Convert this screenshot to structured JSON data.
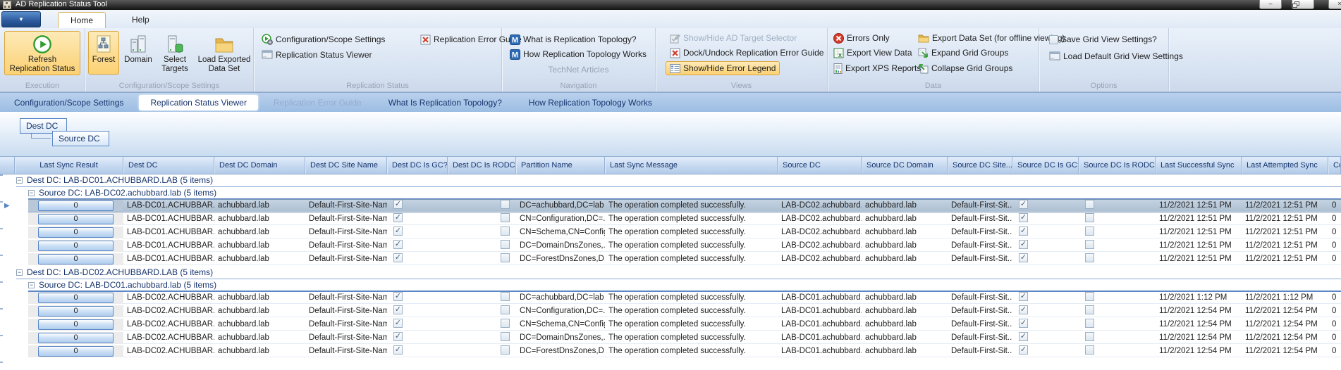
{
  "window": {
    "title": "AD Replication Status Tool"
  },
  "colors": {
    "ribbon_highlight_orange": "#fcd173",
    "selection_row_blue": "#b5c7da",
    "tabstrip_blue": "#a9c6e8",
    "group_text_blue": "#17356e",
    "status_green": "#2e9e2e",
    "error_red": "#d23c2a"
  },
  "icons": {
    "app_menu_arrow": "▼",
    "collapse_box": "−",
    "row_selector": "▶",
    "check": "✓",
    "minimize": "–",
    "close": "×"
  },
  "ribbon": {
    "tabs": {
      "home": "Home",
      "help": "Help"
    },
    "execution": {
      "label": "Execution",
      "refresh": "Refresh Replication Status"
    },
    "scope": {
      "label": "Configuration/Scope Settings",
      "forest": "Forest",
      "domain": "Domain",
      "select_targets": "Select Targets",
      "load_exported": "Load Exported Data Set"
    },
    "replication_status": {
      "label": "Replication Status",
      "config_scope": "Configuration/Scope Settings",
      "viewer": "Replication Status Viewer",
      "error_guide": "Replication Error Guide"
    },
    "navigation": {
      "label": "Navigation",
      "sublabel": "TechNet Articles",
      "what_is": "What is Replication Topology?",
      "how_works": "How Replication Topology Works"
    },
    "views": {
      "label": "Views",
      "target_selector": "Show/Hide AD Target Selector",
      "dock": "Dock/Undock Replication Error Guide",
      "legend": "Show/Hide Error Legend"
    },
    "data": {
      "label": "Data",
      "errors_only": "Errors Only",
      "export_view": "Export View Data",
      "export_xps": "Export XPS Reports",
      "export_dataset": "Export Data Set (for offline viewing)",
      "expand": "Expand Grid Groups",
      "collapse": "Collapse Grid Groups"
    },
    "options": {
      "label": "Options",
      "save": "Save Grid View Settings?",
      "load_default": "Load Default Grid View Settings"
    }
  },
  "view_tabs": [
    {
      "label": "Configuration/Scope Settings",
      "state": "normal"
    },
    {
      "label": "Replication Status Viewer",
      "state": "active"
    },
    {
      "label": "Replication Error Guide",
      "state": "disabled"
    },
    {
      "label": "What Is Replication Topology?",
      "state": "normal"
    },
    {
      "label": "How Replication Topology Works",
      "state": "normal"
    }
  ],
  "group_by": {
    "dest": "Dest DC",
    "source": "Source DC"
  },
  "grid": {
    "columns": [
      {
        "key": "last_sync_result",
        "label": "Last Sync Result",
        "type": "result"
      },
      {
        "key": "dest_dc",
        "label": "Dest DC",
        "type": "text"
      },
      {
        "key": "dest_dc_domain",
        "label": "Dest DC Domain",
        "type": "text"
      },
      {
        "key": "dest_dc_site",
        "label": "Dest DC Site Name",
        "type": "text"
      },
      {
        "key": "dest_gc",
        "label": "Dest DC Is GC?",
        "type": "check"
      },
      {
        "key": "dest_rodc",
        "label": "Dest DC Is RODC?",
        "type": "check"
      },
      {
        "key": "partition",
        "label": "Partition Name",
        "type": "text"
      },
      {
        "key": "message",
        "label": "Last Sync Message",
        "type": "text"
      },
      {
        "key": "source_dc",
        "label": "Source DC",
        "type": "text"
      },
      {
        "key": "source_dc_domain",
        "label": "Source DC Domain",
        "type": "text"
      },
      {
        "key": "source_site",
        "label": "Source DC Site...",
        "type": "text"
      },
      {
        "key": "source_gc",
        "label": "Source DC Is GC?",
        "type": "check"
      },
      {
        "key": "source_rodc",
        "label": "Source DC Is RODC?",
        "type": "check"
      },
      {
        "key": "last_successful",
        "label": "Last Successful Sync",
        "type": "text"
      },
      {
        "key": "last_attempted",
        "label": "Last Attempted Sync",
        "type": "text"
      },
      {
        "key": "consecutive",
        "label": "Co",
        "type": "text"
      }
    ],
    "selected": {
      "group": 0,
      "row": 0
    },
    "groups": [
      {
        "dest_label": "Dest DC: LAB-DC01.ACHUBBARD.LAB (5 items)",
        "source_label": "Source DC: LAB-DC02.achubbard.lab (5 items)",
        "rows": [
          [
            "0",
            "LAB-DC01.ACHUBBAR...",
            "achubbard.lab",
            "Default-First-Site-Name",
            true,
            false,
            "DC=achubbard,DC=lab",
            "The operation completed successfully.",
            "LAB-DC02.achubbard....",
            "achubbard.lab",
            "Default-First-Sit...",
            true,
            false,
            "11/2/2021 12:51 PM",
            "11/2/2021 12:51 PM",
            "0"
          ],
          [
            "0",
            "LAB-DC01.ACHUBBAR...",
            "achubbard.lab",
            "Default-First-Site-Name",
            true,
            false,
            "CN=Configuration,DC=...",
            "The operation completed successfully.",
            "LAB-DC02.achubbard....",
            "achubbard.lab",
            "Default-First-Sit...",
            true,
            false,
            "11/2/2021 12:51 PM",
            "11/2/2021 12:51 PM",
            "0"
          ],
          [
            "0",
            "LAB-DC01.ACHUBBAR...",
            "achubbard.lab",
            "Default-First-Site-Name",
            true,
            false,
            "CN=Schema,CN=Config...",
            "The operation completed successfully.",
            "LAB-DC02.achubbard....",
            "achubbard.lab",
            "Default-First-Sit...",
            true,
            false,
            "11/2/2021 12:51 PM",
            "11/2/2021 12:51 PM",
            "0"
          ],
          [
            "0",
            "LAB-DC01.ACHUBBAR...",
            "achubbard.lab",
            "Default-First-Site-Name",
            true,
            false,
            "DC=DomainDnsZones,...",
            "The operation completed successfully.",
            "LAB-DC02.achubbard....",
            "achubbard.lab",
            "Default-First-Sit...",
            true,
            false,
            "11/2/2021 12:51 PM",
            "11/2/2021 12:51 PM",
            "0"
          ],
          [
            "0",
            "LAB-DC01.ACHUBBAR...",
            "achubbard.lab",
            "Default-First-Site-Name",
            true,
            false,
            "DC=ForestDnsZones,D...",
            "The operation completed successfully.",
            "LAB-DC02.achubbard....",
            "achubbard.lab",
            "Default-First-Sit...",
            true,
            false,
            "11/2/2021 12:51 PM",
            "11/2/2021 12:51 PM",
            "0"
          ]
        ]
      },
      {
        "dest_label": "Dest DC: LAB-DC02.ACHUBBARD.LAB (5 items)",
        "source_label": "Source DC: LAB-DC01.achubbard.lab (5 items)",
        "rows": [
          [
            "0",
            "LAB-DC02.ACHUBBAR...",
            "achubbard.lab",
            "Default-First-Site-Name",
            true,
            false,
            "DC=achubbard,DC=lab",
            "The operation completed successfully.",
            "LAB-DC01.achubbard....",
            "achubbard.lab",
            "Default-First-Sit...",
            true,
            false,
            "11/2/2021 1:12 PM",
            "11/2/2021 1:12 PM",
            "0"
          ],
          [
            "0",
            "LAB-DC02.ACHUBBAR...",
            "achubbard.lab",
            "Default-First-Site-Name",
            true,
            false,
            "CN=Configuration,DC=...",
            "The operation completed successfully.",
            "LAB-DC01.achubbard....",
            "achubbard.lab",
            "Default-First-Sit...",
            true,
            false,
            "11/2/2021 12:54 PM",
            "11/2/2021 12:54 PM",
            "0"
          ],
          [
            "0",
            "LAB-DC02.ACHUBBAR...",
            "achubbard.lab",
            "Default-First-Site-Name",
            true,
            false,
            "CN=Schema,CN=Config...",
            "The operation completed successfully.",
            "LAB-DC01.achubbard....",
            "achubbard.lab",
            "Default-First-Sit...",
            true,
            false,
            "11/2/2021 12:54 PM",
            "11/2/2021 12:54 PM",
            "0"
          ],
          [
            "0",
            "LAB-DC02.ACHUBBAR...",
            "achubbard.lab",
            "Default-First-Site-Name",
            true,
            false,
            "DC=DomainDnsZones,...",
            "The operation completed successfully.",
            "LAB-DC01.achubbard....",
            "achubbard.lab",
            "Default-First-Sit...",
            true,
            false,
            "11/2/2021 12:54 PM",
            "11/2/2021 12:54 PM",
            "0"
          ],
          [
            "0",
            "LAB-DC02.ACHUBBAR...",
            "achubbard.lab",
            "Default-First-Site-Name",
            true,
            false,
            "DC=ForestDnsZones,D...",
            "The operation completed successfully.",
            "LAB-DC01.achubbard....",
            "achubbard.lab",
            "Default-First-Sit...",
            true,
            false,
            "11/2/2021 12:54 PM",
            "11/2/2021 12:54 PM",
            "0"
          ]
        ]
      }
    ]
  }
}
